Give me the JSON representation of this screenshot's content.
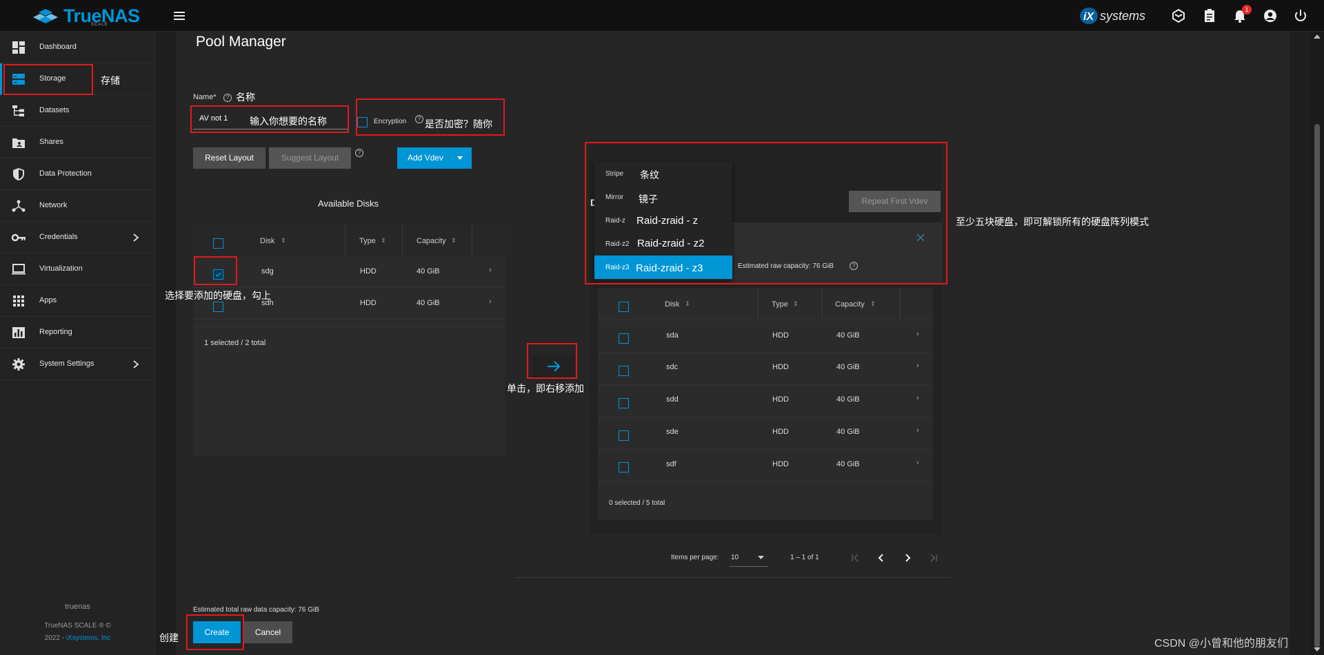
{
  "app": {
    "logo_name": "TrueNAS",
    "logo_edition": "SCALE",
    "vendor": "iXsystems",
    "notification_count": "1"
  },
  "sidebar": {
    "items": [
      {
        "label": "Dashboard",
        "icon": "dashboard-icon"
      },
      {
        "label": "Storage",
        "icon": "storage-icon"
      },
      {
        "label": "Datasets",
        "icon": "datasets-icon"
      },
      {
        "label": "Shares",
        "icon": "shares-icon"
      },
      {
        "label": "Data Protection",
        "icon": "shield-icon"
      },
      {
        "label": "Network",
        "icon": "network-icon"
      },
      {
        "label": "Credentials",
        "icon": "key-icon"
      },
      {
        "label": "Virtualization",
        "icon": "monitor-icon"
      },
      {
        "label": "Apps",
        "icon": "apps-grid-icon"
      },
      {
        "label": "Reporting",
        "icon": "chart-icon"
      },
      {
        "label": "System Settings",
        "icon": "gear-icon"
      }
    ],
    "hostname": "truenas",
    "version": "TrueNAS SCALE ® ©",
    "copyright_year": "2022 - ",
    "copyright_link": "iXsystems, Inc"
  },
  "main": {
    "title": "Pool Manager",
    "name_label": "Name*",
    "name_value": "AV not 1",
    "encryption_label": "Encryption",
    "buttons": {
      "reset_layout": "Reset Layout",
      "suggest_layout": "Suggest Layout",
      "add_vdev": "Add Vdev",
      "repeat_first_vdev": "Repeat First Vdev",
      "create": "Create",
      "cancel": "Cancel"
    },
    "available": {
      "title": "Available Disks",
      "columns": [
        "Disk",
        "Type",
        "Capacity"
      ],
      "rows": [
        {
          "disk": "sdg",
          "type": "HDD",
          "capacity": "40 GiB",
          "checked": true
        },
        {
          "disk": "sdh",
          "type": "HDD",
          "capacity": "40 GiB",
          "checked": false
        }
      ],
      "footer": "1 selected / 2 total"
    },
    "vdev": {
      "title_initial": "D",
      "estimated_raw": "Estimated raw capacity: 76 GiB",
      "columns": [
        "Disk",
        "Type",
        "Capacity"
      ],
      "rows": [
        {
          "disk": "sda",
          "type": "HDD",
          "capacity": "40 GiB"
        },
        {
          "disk": "sdc",
          "type": "HDD",
          "capacity": "40 GiB"
        },
        {
          "disk": "sdd",
          "type": "HDD",
          "capacity": "40 GiB"
        },
        {
          "disk": "sde",
          "type": "HDD",
          "capacity": "40 GiB"
        },
        {
          "disk": "sdf",
          "type": "HDD",
          "capacity": "40 GiB"
        }
      ],
      "footer": "0 selected / 5 total"
    },
    "dropdown": [
      {
        "small": "Stripe",
        "note": "条纹"
      },
      {
        "small": "Mirror",
        "note": "镜子"
      },
      {
        "small": "Raid-z",
        "note": "Raid-zraid - z"
      },
      {
        "small": "Raid-z2",
        "note": "Raid-zraid - z2"
      },
      {
        "small": "Raid-z3",
        "note": "Raid-zraid - z3",
        "selected": true
      }
    ],
    "paginator": {
      "items_label": "Items per page:",
      "page_size": "10",
      "range": "1 – 1 of 1"
    },
    "estimated_total": "Estimated total raw data capacity: 76 GiB"
  },
  "annotations": {
    "storage": "存储",
    "name": "名称",
    "name_hint": "输入你想要的名称",
    "encryption": "是否加密？随你",
    "select_disk": "选择要添加的硬盘，勾上",
    "click_move": "单击，即右移添加",
    "five_disks": "至少五块硬盘，即可解锁所有的硬盘阵列模式",
    "create": "创建",
    "watermark": "CSDN @小曾和他的朋友们"
  },
  "colors": {
    "accent": "#0095d5",
    "annotation_red": "#e3191b",
    "background": "#1e1e1e"
  }
}
